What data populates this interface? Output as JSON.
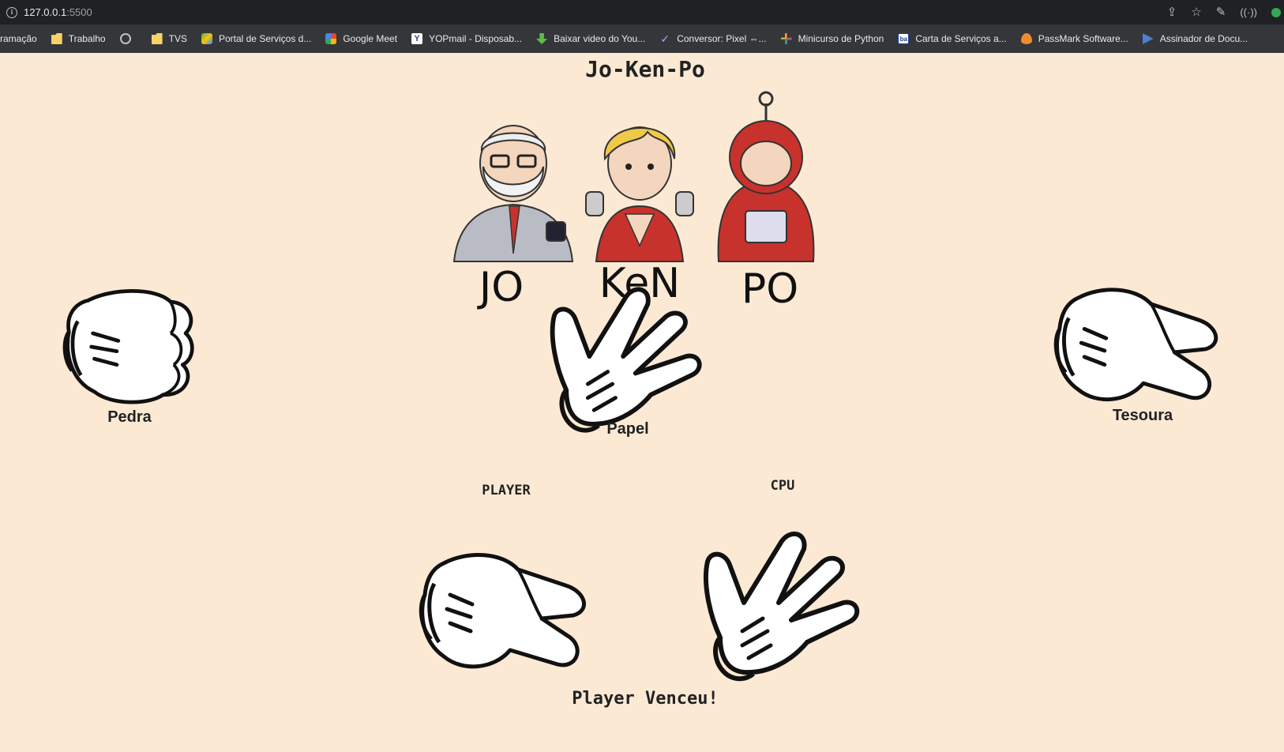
{
  "browser": {
    "url_host": "127.0.0.1",
    "url_port": ":5500",
    "bookmarks": [
      {
        "label": "ramação",
        "icon": "none"
      },
      {
        "label": "Trabalho",
        "icon": "folder-icon"
      },
      {
        "label": "",
        "icon": "globe-icon"
      },
      {
        "label": "TVS",
        "icon": "folder-icon"
      },
      {
        "label": "Portal de Serviços d...",
        "icon": "gov-portal-icon"
      },
      {
        "label": "Google Meet",
        "icon": "google-meet-icon"
      },
      {
        "label": "YOPmail - Disposab...",
        "icon": "yopmail-icon"
      },
      {
        "label": "Baixar video do You...",
        "icon": "download-icon"
      },
      {
        "label": "Conversor: Pixel ⇔...",
        "icon": "check-icon"
      },
      {
        "label": "Minicurso de Python",
        "icon": "plus-icon"
      },
      {
        "label": "Carta de Serviços a...",
        "icon": "ba-icon"
      },
      {
        "label": "PassMark Software...",
        "icon": "flame-icon"
      },
      {
        "label": "Assinador de Docu...",
        "icon": "sign-icon"
      }
    ]
  },
  "game": {
    "title": "Jo-Ken-Po",
    "logo_words": [
      "JO",
      "KeN",
      "PO"
    ],
    "options": {
      "rock": "Pedra",
      "paper": "Papel",
      "scissors": "Tesoura"
    },
    "player_label": "PLAYER",
    "cpu_label": "CPU",
    "player_choice": "scissors",
    "cpu_choice": "paper",
    "result": "Player Venceu!"
  },
  "colors": {
    "page_background": "#fbe9d4",
    "text": "#222222"
  }
}
